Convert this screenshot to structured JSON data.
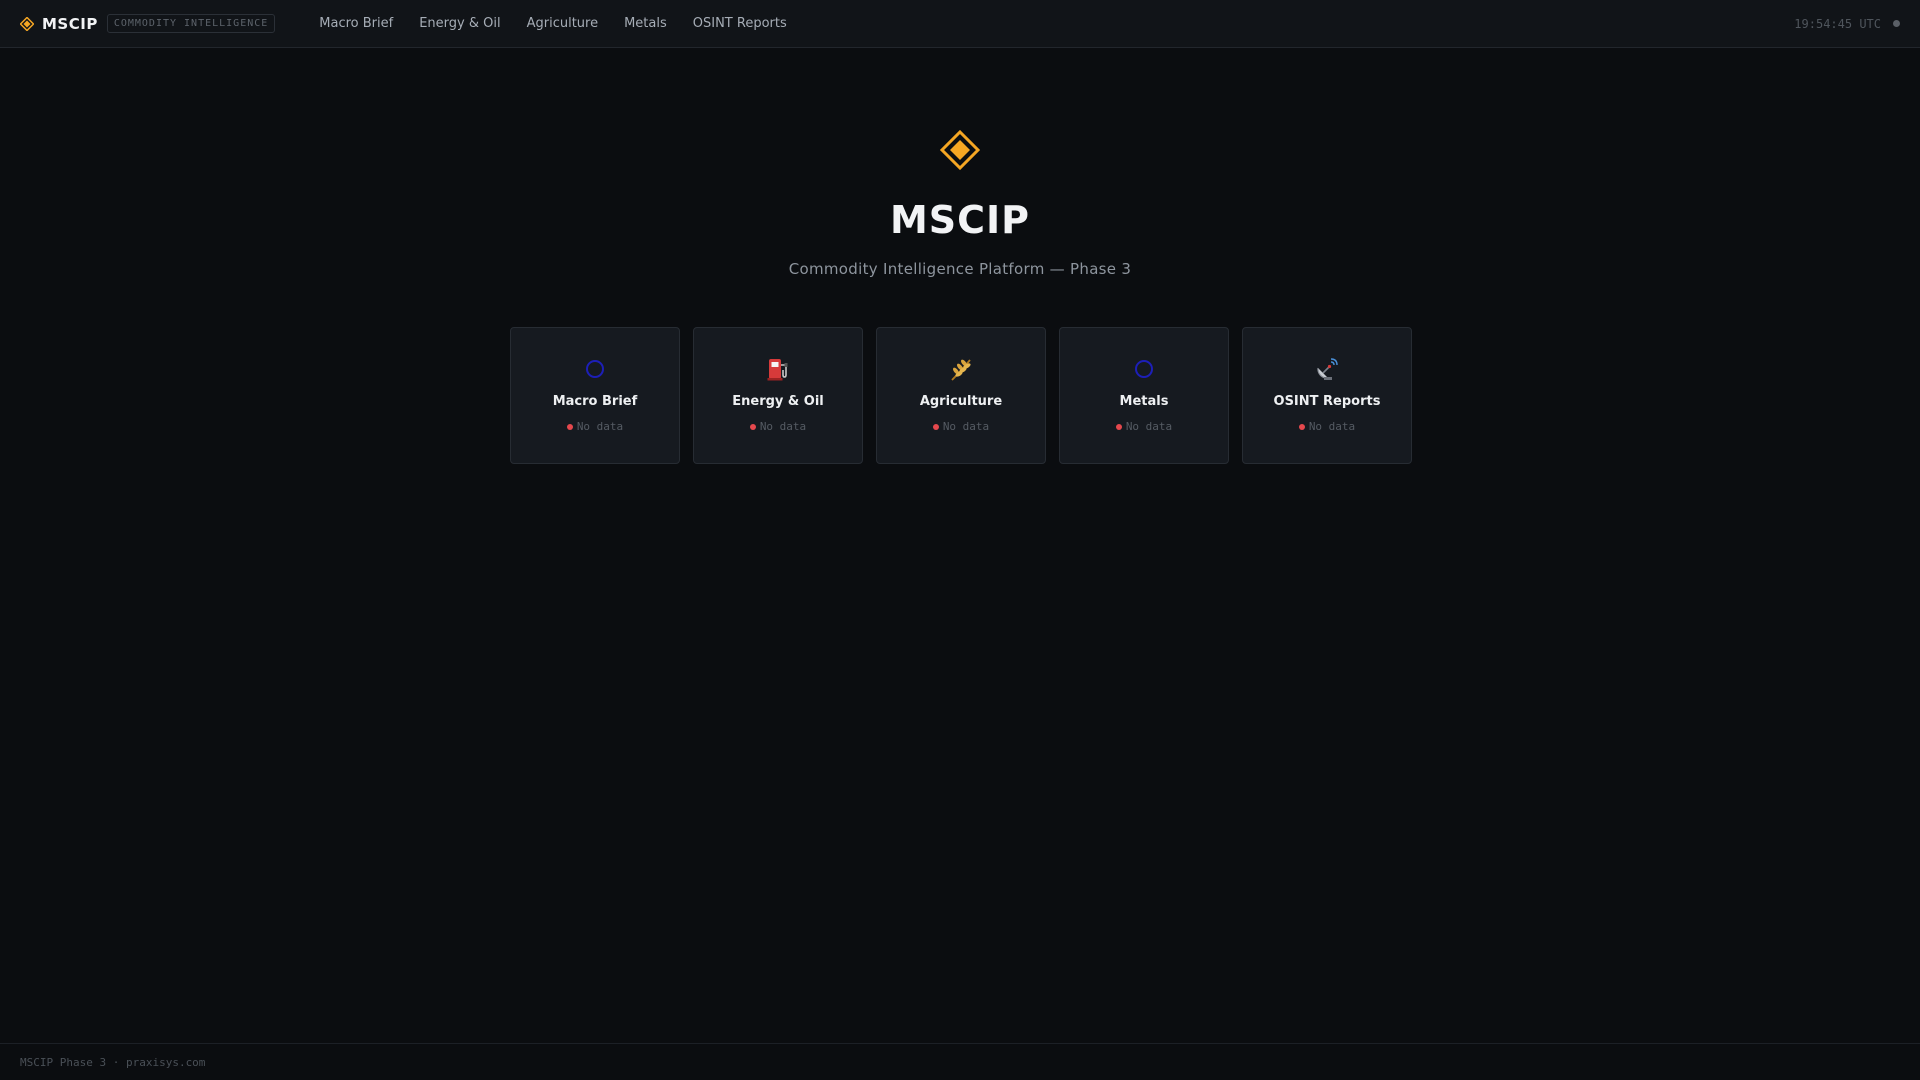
{
  "header": {
    "brand": "MSCIP",
    "tag": "COMMODITY INTELLIGENCE",
    "nav": [
      {
        "label": "Macro Brief"
      },
      {
        "label": "Energy & Oil"
      },
      {
        "label": "Agriculture"
      },
      {
        "label": "Metals"
      },
      {
        "label": "OSINT Reports"
      }
    ],
    "clock": "19:54:45 UTC"
  },
  "hero": {
    "title": "MSCIP",
    "subtitle": "Commodity Intelligence Platform — Phase 3"
  },
  "cards": [
    {
      "label": "Macro Brief",
      "icon": "ring-icon",
      "status": "No data"
    },
    {
      "label": "Energy & Oil",
      "icon": "fuel-pump-icon",
      "status": "No data"
    },
    {
      "label": "Agriculture",
      "icon": "wheat-icon",
      "status": "No data"
    },
    {
      "label": "Metals",
      "icon": "ring-icon",
      "status": "No data"
    },
    {
      "label": "OSINT Reports",
      "icon": "satellite-dish-icon",
      "status": "No data"
    }
  ],
  "footer": {
    "text": "MSCIP Phase 3 · praxisys.com"
  },
  "colors": {
    "accent": "#f5a623",
    "status_error": "#e5484d",
    "ring": "#1d1fb8"
  }
}
